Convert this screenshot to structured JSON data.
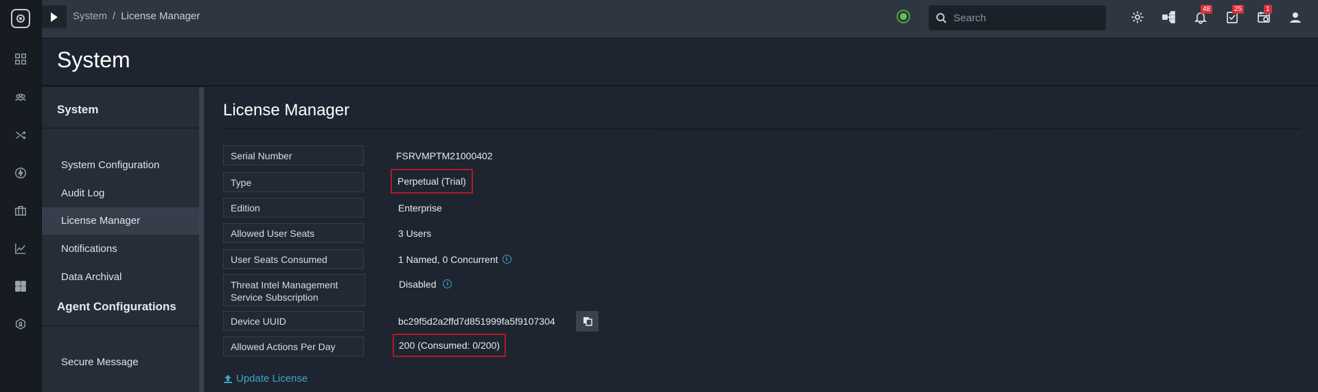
{
  "header": {
    "breadcrumb": [
      "System",
      "License Manager"
    ],
    "breadcrumb_sep": "/",
    "search_placeholder": "Search",
    "badges": {
      "notifications": "48",
      "tasks": "25",
      "jobs": "1"
    }
  },
  "page_title": "System",
  "sidebar": {
    "section_title": "System",
    "items": [
      {
        "label": "System Configuration"
      },
      {
        "label": "Audit Log"
      },
      {
        "label": "License Manager",
        "active": true
      },
      {
        "label": "Notifications"
      },
      {
        "label": "Data Archival"
      }
    ],
    "section2_title": "Agent Configurations",
    "items2": [
      {
        "label": "Secure Message"
      }
    ]
  },
  "main": {
    "title": "License Manager",
    "rows": [
      {
        "label": "Serial Number",
        "value": "FSRVMPTM21000402"
      },
      {
        "label": "Type",
        "value": "Perpetual (Trial)"
      },
      {
        "label": "Edition",
        "value": "Enterprise"
      },
      {
        "label": "Allowed User Seats",
        "value": "3 Users"
      },
      {
        "label": "User Seats Consumed",
        "value": "1 Named, 0 Concurrent"
      },
      {
        "label": "Threat Intel Management Service Subscription",
        "value": "Disabled"
      },
      {
        "label": "Device UUID",
        "value": "bc29f5d2a2ffd7d851999fa5f9107304"
      },
      {
        "label": "Allowed Actions Per Day",
        "value": "200 (Consumed: 0/200)"
      }
    ],
    "update_link": "Update License"
  },
  "colors": {
    "accent": "#3fa6c8",
    "highlight": "#b01c26",
    "status_ok": "#6cc04a"
  }
}
